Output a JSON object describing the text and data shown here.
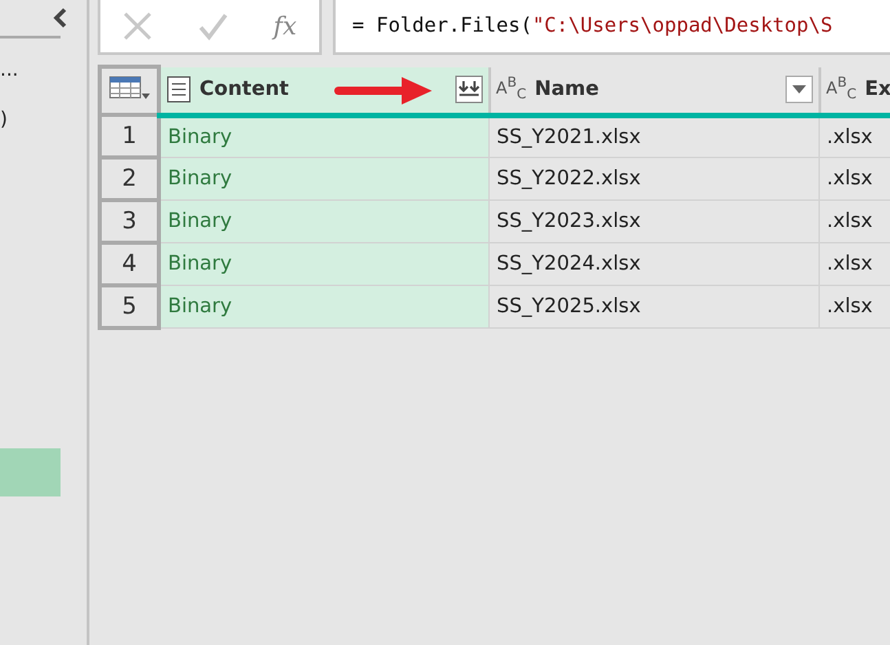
{
  "sidebar": {
    "items": [
      {
        "label": "...",
        "selected": false
      },
      {
        "label": ")",
        "selected": false
      },
      {
        "selected": true
      }
    ]
  },
  "formula_bar": {
    "fx_label": "fx",
    "formula_prefix": "= Folder.Files(",
    "formula_string": "\"C:\\Users\\oppad\\Desktop\\S"
  },
  "table": {
    "columns": [
      {
        "label": "Content",
        "kind": "binary",
        "selected": true
      },
      {
        "label": "Name",
        "kind": "text",
        "type_icon": "A$^{B}$$_{C}$",
        "selected": false
      },
      {
        "label": "Ex",
        "kind": "text",
        "type_icon": "A$^{B}$$_{C}$",
        "selected": false
      }
    ],
    "rows": [
      {
        "number": "1",
        "cells": [
          "Binary",
          "SS_Y2021.xlsx",
          ".xlsx"
        ]
      },
      {
        "number": "2",
        "cells": [
          "Binary",
          "SS_Y2022.xlsx",
          ".xlsx"
        ]
      },
      {
        "number": "3",
        "cells": [
          "Binary",
          "SS_Y2023.xlsx",
          ".xlsx"
        ]
      },
      {
        "number": "4",
        "cells": [
          "Binary",
          "SS_Y2024.xlsx",
          ".xlsx"
        ]
      },
      {
        "number": "5",
        "cells": [
          "Binary",
          "SS_Y2025.xlsx",
          ".xlsx"
        ]
      }
    ]
  }
}
